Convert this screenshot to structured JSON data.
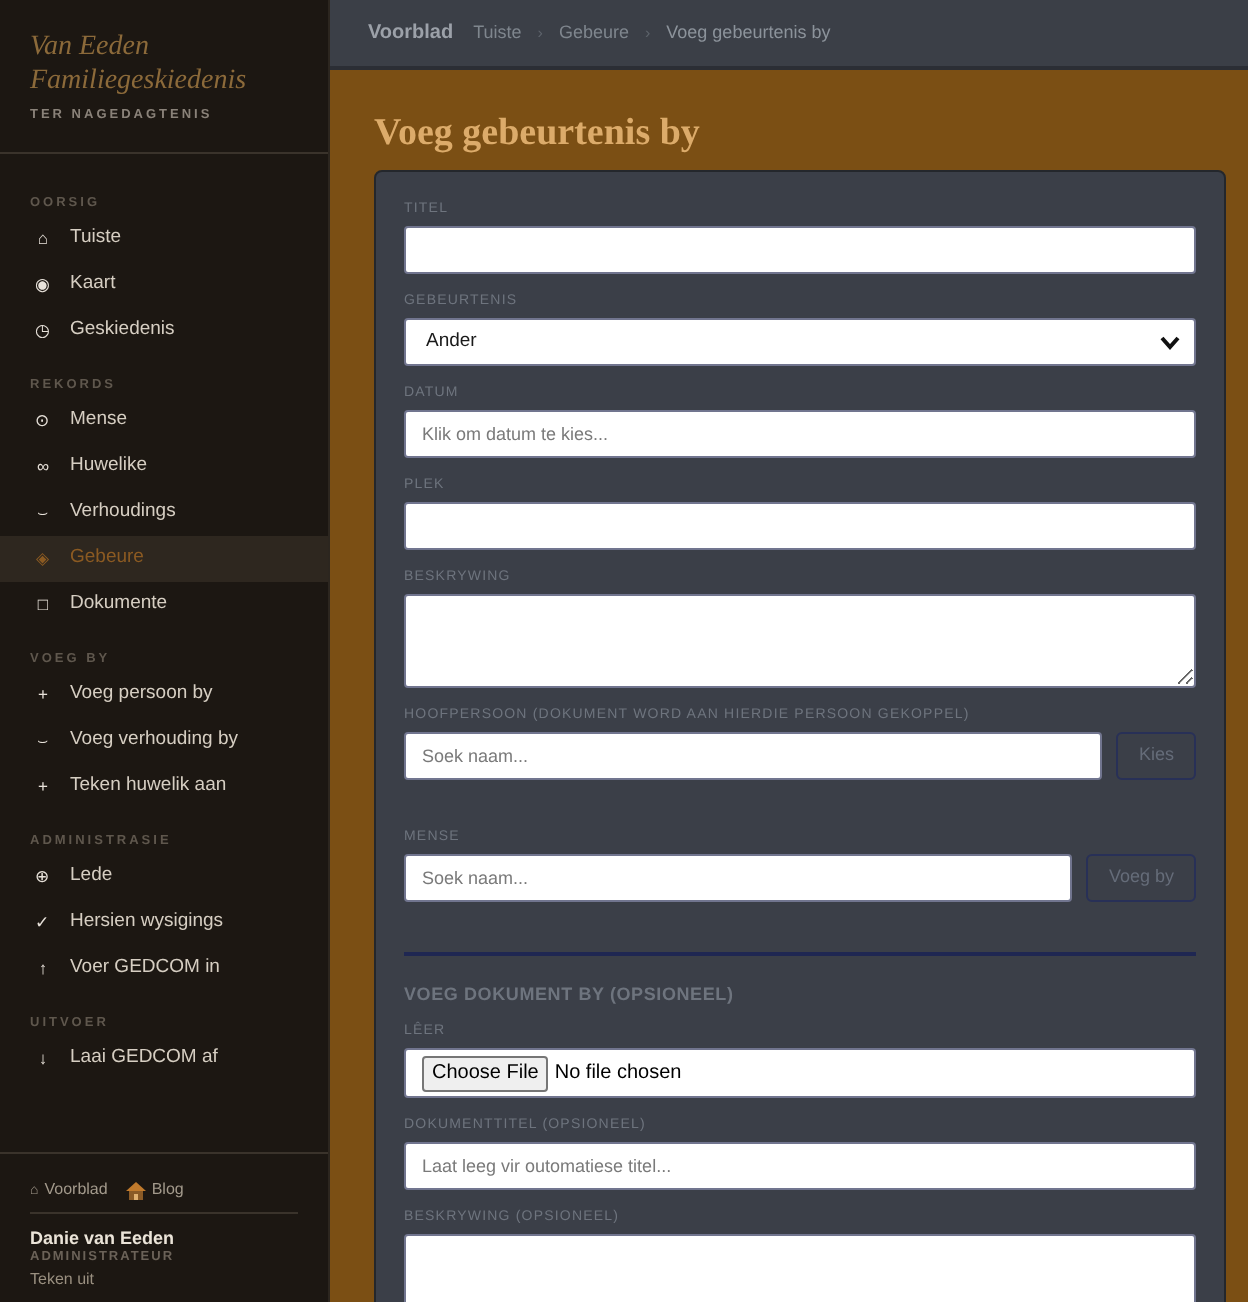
{
  "sidebar": {
    "title": "Van Eeden Familiegeskiedenis",
    "subtitle": "TER NAGEDAGTENIS",
    "sections": [
      {
        "heading": "OORSIG",
        "items": [
          {
            "icon": "⌂",
            "label": "Tuiste",
            "selected": false
          },
          {
            "icon": "◉",
            "label": "Kaart",
            "selected": false
          },
          {
            "icon": "◷",
            "label": "Geskiedenis",
            "selected": false
          }
        ]
      },
      {
        "heading": "REKORDS",
        "items": [
          {
            "icon": "⊙",
            "label": "Mense",
            "selected": false
          },
          {
            "icon": "∞",
            "label": "Huwelike",
            "selected": false
          },
          {
            "icon": "⌣",
            "label": "Verhoudings",
            "selected": false
          },
          {
            "icon": "◈",
            "label": "Gebeure",
            "selected": true
          },
          {
            "icon": "□",
            "label": "Dokumente",
            "selected": false
          }
        ]
      },
      {
        "heading": "VOEG BY",
        "items": [
          {
            "icon": "+",
            "label": "Voeg persoon by",
            "selected": false
          },
          {
            "icon": "⌣",
            "label": "Voeg verhouding by",
            "selected": false
          },
          {
            "icon": "+",
            "label": "Teken huwelik aan",
            "selected": false
          }
        ]
      },
      {
        "heading": "ADMINISTRASIE",
        "items": [
          {
            "icon": "⊕",
            "label": "Lede",
            "selected": false
          },
          {
            "icon": "✓",
            "label": "Hersien wysigings",
            "selected": false
          },
          {
            "icon": "↑",
            "label": "Voer GEDCOM in",
            "selected": false
          }
        ]
      },
      {
        "heading": "UITVOER",
        "items": [
          {
            "icon": "↓",
            "label": "Laai GEDCOM af",
            "selected": false
          }
        ]
      }
    ],
    "footer": {
      "links": [
        {
          "icon": "⌂",
          "label": "Voorblad"
        },
        {
          "label": "Blog"
        }
      ],
      "user": {
        "name": "Danie van Eeden",
        "role": "ADMINISTRATEUR",
        "action": "Teken uit"
      }
    }
  },
  "breadcrumb": {
    "brand": "Voorblad",
    "trail": [
      {
        "kind": "link",
        "label": "Tuiste"
      },
      {
        "kind": "separator",
        "label": "›"
      },
      {
        "kind": "link",
        "label": "Gebeure"
      },
      {
        "kind": "separator",
        "label": "›"
      },
      {
        "kind": "current",
        "label": "Voeg gebeurtenis by"
      }
    ]
  },
  "page": {
    "title": "Voeg gebeurtenis by",
    "form": {
      "fields": [
        {
          "kind": "text",
          "label": "TITEL"
        },
        {
          "kind": "select",
          "label": "GEBEURTENIS",
          "value": "Ander"
        },
        {
          "kind": "text",
          "label": "DATUM",
          "placeholder": "Klik om datum te kies..."
        },
        {
          "kind": "text",
          "label": "PLEK"
        },
        {
          "kind": "textarea",
          "label": "BESKRYWING"
        },
        {
          "kind": "search",
          "label": "HOOFPERSOON (DOKUMENT WORD AAN HIERDIE PERSOON GEKOPPEL)",
          "placeholder": "Soek naam...",
          "button": "Kies",
          "disabled": true
        },
        {
          "kind": "search",
          "label": "MENSE",
          "placeholder": "Soek naam...",
          "button": "Voeg by",
          "disabled": true
        },
        {
          "kind": "divider"
        },
        {
          "kind": "heading",
          "label": "VOEG DOKUMENT BY (OPSIONEEL)"
        },
        {
          "kind": "file",
          "label": "LÊER",
          "button": "Choose File",
          "status": "No file chosen"
        },
        {
          "kind": "text",
          "label": "DOKUMENTTITEL (OPSIONEEL)",
          "placeholder": "Laat leeg vir outomatiese titel..."
        },
        {
          "kind": "textarea",
          "label": "BESKRYWING (OPSIONEEL)"
        }
      ]
    }
  }
}
